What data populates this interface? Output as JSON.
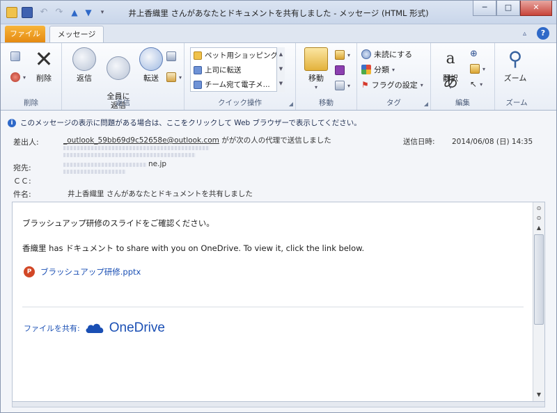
{
  "window": {
    "title": "井上香織里 さんがあなたとドキュメントを共有しました - メッセージ (HTML 形式)",
    "controls": {
      "minimize": "─",
      "maximize": "□",
      "close": "✕"
    }
  },
  "tabs": {
    "file": "ファイル",
    "message": "メッセージ"
  },
  "ribbon": {
    "delete_group": {
      "label": "削除",
      "delete": "削除"
    },
    "respond_group": {
      "label": "返信",
      "reply": "返信",
      "reply_all": "全員に\n返信",
      "forward": "転送"
    },
    "quick_group": {
      "label": "クイック操作",
      "items": [
        "ペット用ショッピング",
        "上司に転送",
        "チーム宛て電子メ..."
      ]
    },
    "move_group": {
      "label": "移動",
      "move": "移動"
    },
    "tags_group": {
      "label": "タグ",
      "unread": "未読にする",
      "categorize": "分類",
      "followup": "フラグの設定"
    },
    "edit_group": {
      "label": "編集",
      "translate": "翻訳"
    },
    "zoom_group": {
      "label": "ズーム",
      "zoom": "ズーム"
    }
  },
  "infobar": {
    "text": "このメッセージの表示に問題がある場合は、ここをクリックして Web ブラウザーで表示してください。"
  },
  "headers": {
    "from_label": "差出人:",
    "from_value": "_outlook_59bb69d9c52658e@outlook.com",
    "from_suffix": "がが次の人の代理で送信しました",
    "sent_label": "送信日時:",
    "sent_value": "2014/06/08 (日) 14:35",
    "to_label": "宛先:",
    "to_domain": "ne.jp",
    "cc_label": "ＣＣ:",
    "subject_label": "件名:",
    "subject_value": "井上香織里 さんがあなたとドキュメントを共有しました"
  },
  "body": {
    "line1": "ブラッシュアップ研修のスライドをご確認ください。",
    "line2": "香織里 has ドキュメント to share with you on OneDrive. To view it, click the link below.",
    "attachment": "ブラッシュアップ研修.pptx",
    "onedrive_prefix": "ファイルを共有:",
    "onedrive_name": "OneDrive"
  }
}
